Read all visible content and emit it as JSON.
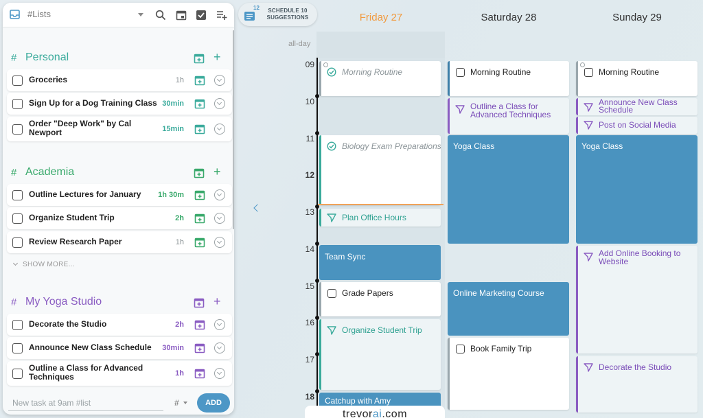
{
  "app": {
    "list_selector": "#Lists"
  },
  "colors": {
    "accent_blue": "#4d97c6",
    "personal_teal": "#3bab9c",
    "academia_green": "#39a96b",
    "yoga_purple": "#8a5cc2",
    "today_orange": "#f19a3e"
  },
  "sidebar": {
    "sections": [
      {
        "hash": "#",
        "title": "Personal",
        "tasks": [
          {
            "label": "Groceries",
            "duration": "1h"
          },
          {
            "label": "Sign Up for a Dog Training Class",
            "duration": "30min"
          },
          {
            "label": "Order \"Deep Work\" by Cal Newport",
            "duration": "15min"
          }
        ]
      },
      {
        "hash": "#",
        "title": "Academia",
        "tasks": [
          {
            "label": "Outline Lectures for January",
            "duration": "1h 30m"
          },
          {
            "label": "Organize Student Trip",
            "duration": "2h"
          },
          {
            "label": "Review Research Paper",
            "duration": "1h"
          }
        ],
        "show_more": "SHOW MORE..."
      },
      {
        "hash": "#",
        "title": "My Yoga Studio",
        "tasks": [
          {
            "label": "Decorate the Studio",
            "duration": "2h"
          },
          {
            "label": "Announce New Class Schedule",
            "duration": "30min"
          },
          {
            "label": "Outline a Class for Advanced Techniques",
            "duration": "1h"
          }
        ]
      }
    ],
    "new_task_placeholder": "New task at 9am #list",
    "hash_selector": "#",
    "add_label": "ADD"
  },
  "suggestions": {
    "count": "12",
    "label": "SCHEDULE 10 SUGGESTIONS"
  },
  "calendar": {
    "days": [
      "Friday 27",
      "Saturday 28",
      "Sunday 29"
    ],
    "allday_label": "all-day",
    "hours": [
      "09",
      "10",
      "11",
      "12",
      "13",
      "14",
      "15",
      "16",
      "17",
      "18"
    ],
    "events": {
      "fri_morning": "Morning Routine",
      "fri_biology": "Biology Exam Preparations",
      "fri_office": "Plan Office Hours",
      "fri_teamsync": "Team Sync",
      "fri_grade": "Grade Papers",
      "fri_trip": "Organize Student Trip",
      "fri_catchup": "Catchup with Amy",
      "sat_morning": "Morning Routine",
      "sat_outline": "Outline a Class for Advanced Techniques",
      "sat_yoga": "Yoga Class",
      "sat_marketing": "Online Marketing Course",
      "sat_family": "Book Family Trip",
      "sun_morning": "Morning Routine",
      "sun_announce": "Announce New Class Schedule",
      "sun_social": "Post on Social Media",
      "sun_yoga": "Yoga Class",
      "sun_booking": "Add Online Booking to Website",
      "sun_decorate": "Decorate the Studio"
    }
  },
  "watermark": {
    "prefix": "trevor",
    "suffix": "ai",
    "domain": ".com"
  }
}
